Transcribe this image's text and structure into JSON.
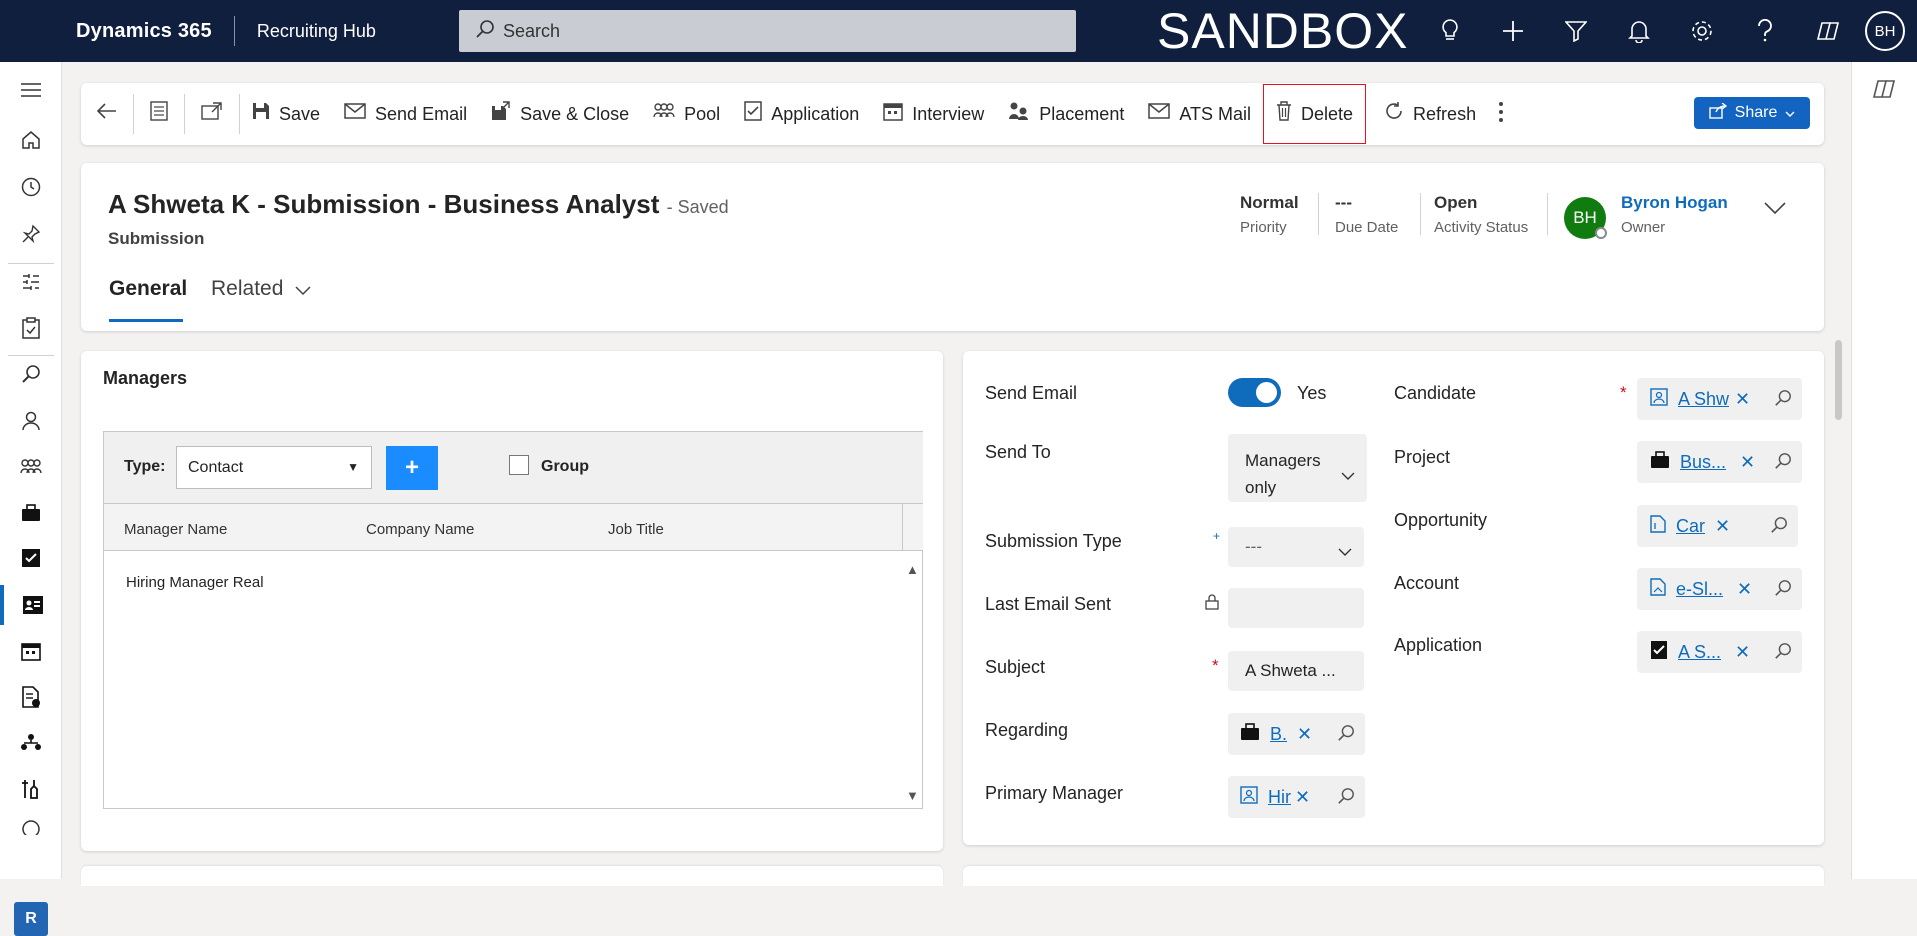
{
  "topbar": {
    "brand": "Dynamics 365",
    "app_name": "Recruiting Hub",
    "search_placeholder": "Search",
    "environment_badge": "SANDBOX",
    "user_initials": "BH",
    "icons": [
      "lightbulb-icon",
      "plus-icon",
      "filter-icon",
      "bell-icon",
      "gear-icon",
      "help-icon",
      "copilot-icon"
    ]
  },
  "leftnav": {
    "items": [
      "menu-icon",
      "home-icon",
      "recent-icon",
      "pin-icon",
      "workspace-icon",
      "tasks-icon",
      "search-icon",
      "contacts-icon",
      "pools-icon",
      "projects-icon",
      "applications-icon",
      "submissions-icon",
      "interviews-icon",
      "invoices-icon",
      "placements-icon",
      "tools-icon",
      "globe-icon"
    ],
    "active": "submissions-icon",
    "area_switcher": "R"
  },
  "commandbar": {
    "back": "back-icon",
    "save": "Save",
    "send_email": "Send Email",
    "save_close": "Save & Close",
    "pool": "Pool",
    "application": "Application",
    "interview": "Interview",
    "placement": "Placement",
    "ats_mail": "ATS Mail",
    "delete": "Delete",
    "refresh": "Refresh",
    "share": "Share"
  },
  "header": {
    "title": "A Shweta K - Submission - Business Analyst",
    "save_status": "- Saved",
    "entity": "Submission",
    "fields": {
      "priority_value": "Normal",
      "priority_label": "Priority",
      "due_value": "---",
      "due_label": "Due Date",
      "status_value": "Open",
      "status_label": "Activity Status",
      "owner_name": "Byron Hogan",
      "owner_label": "Owner",
      "owner_initials": "BH"
    },
    "tabs": {
      "general": "General",
      "related": "Related"
    }
  },
  "managers": {
    "title": "Managers",
    "type_label": "Type:",
    "type_value": "Contact",
    "group_label": "Group",
    "columns": [
      "Manager Name",
      "Company Name",
      "Job Title"
    ],
    "rows": [
      "Hiring Manager Real"
    ]
  },
  "form": {
    "send_email_label": "Send Email",
    "send_email_value": "Yes",
    "send_to_label": "Send To",
    "send_to_value_1": "Managers",
    "send_to_value_2": "only",
    "submission_type_label": "Submission Type",
    "submission_type_value": "---",
    "last_email_label": "Last Email Sent",
    "subject_label": "Subject",
    "subject_value": "A Shweta ...",
    "regarding_label": "Regarding",
    "regarding_value": "B.",
    "primary_manager_label": "Primary Manager",
    "primary_manager_value": "Hir",
    "candidate_label": "Candidate",
    "candidate_value": "A Shw",
    "project_label": "Project",
    "project_value": "Bus...",
    "opportunity_label": "Opportunity",
    "opportunity_value": "Car",
    "account_label": "Account",
    "account_value": "e-Sl...",
    "application_label": "Application",
    "application_value": "A S..."
  }
}
